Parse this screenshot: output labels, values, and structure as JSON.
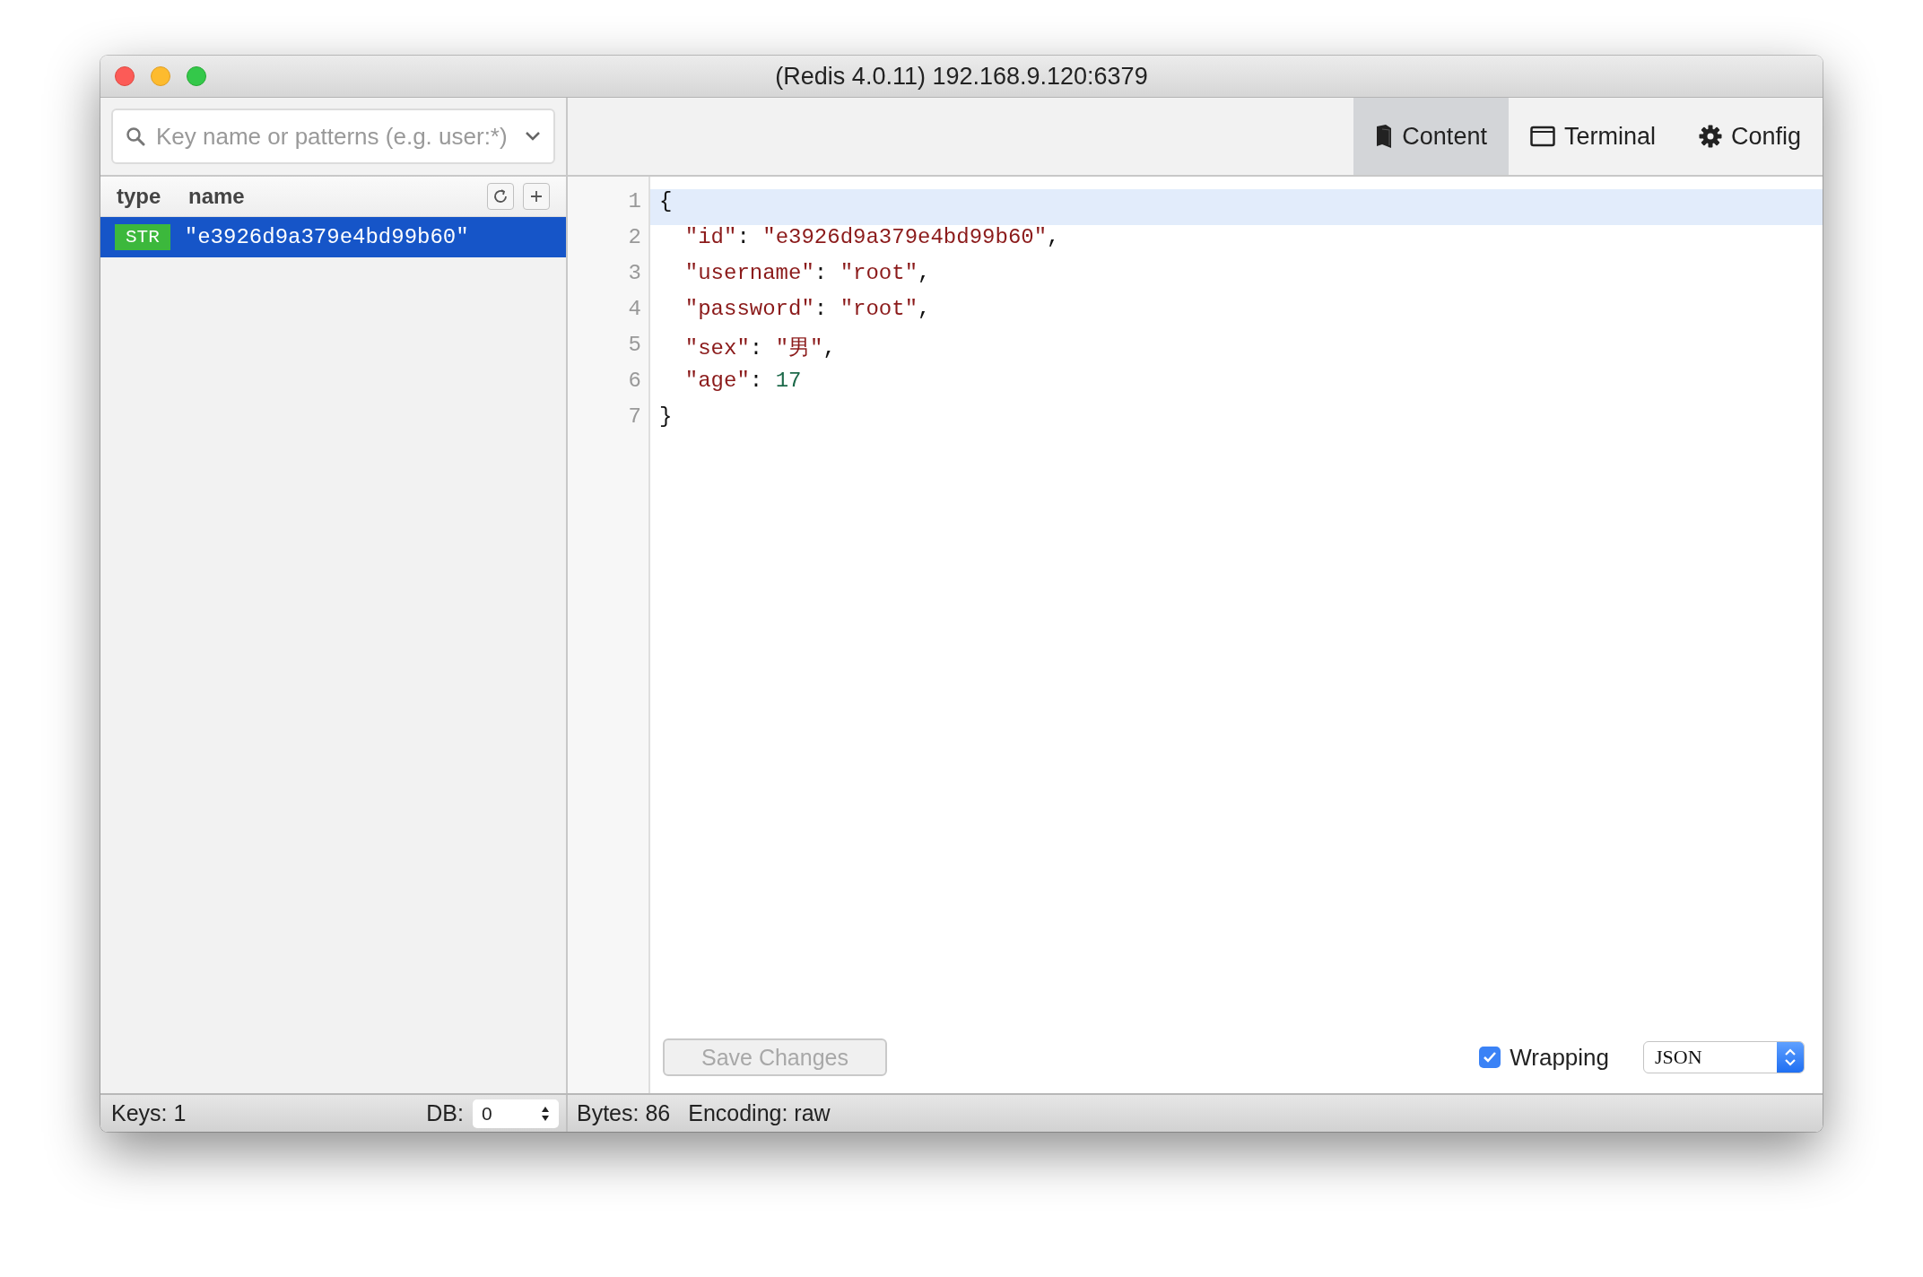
{
  "window": {
    "title": "(Redis 4.0.11) 192.168.9.120:6379"
  },
  "search": {
    "placeholder": "Key name or patterns (e.g. user:*)"
  },
  "key_list": {
    "columns": [
      "type",
      "name"
    ],
    "keys": [
      {
        "type": "STR",
        "name": "\"e3926d9a379e4bd99b60\"",
        "selected": true
      }
    ]
  },
  "tabs": [
    {
      "label": "Content",
      "selected": true
    },
    {
      "label": "Terminal",
      "selected": false
    },
    {
      "label": "Config",
      "selected": false
    }
  ],
  "editor": {
    "lines": [
      {
        "number": "1",
        "highlighted": true,
        "tokens": [
          {
            "kind": "punct",
            "text": "{"
          }
        ]
      },
      {
        "number": "2",
        "highlighted": false,
        "tokens": [
          {
            "kind": "key",
            "text": "  \"id\""
          },
          {
            "kind": "punct",
            "text": ": "
          },
          {
            "kind": "string",
            "text": "\"e3926d9a379e4bd99b60\""
          },
          {
            "kind": "punct",
            "text": ","
          }
        ]
      },
      {
        "number": "3",
        "highlighted": false,
        "tokens": [
          {
            "kind": "key",
            "text": "  \"username\""
          },
          {
            "kind": "punct",
            "text": ": "
          },
          {
            "kind": "string",
            "text": "\"root\""
          },
          {
            "kind": "punct",
            "text": ","
          }
        ]
      },
      {
        "number": "4",
        "highlighted": false,
        "tokens": [
          {
            "kind": "key",
            "text": "  \"password\""
          },
          {
            "kind": "punct",
            "text": ": "
          },
          {
            "kind": "string",
            "text": "\"root\""
          },
          {
            "kind": "punct",
            "text": ","
          }
        ]
      },
      {
        "number": "5",
        "highlighted": false,
        "tokens": [
          {
            "kind": "key",
            "text": "  \"sex\""
          },
          {
            "kind": "punct",
            "text": ": "
          },
          {
            "kind": "string",
            "text": "\"男\""
          },
          {
            "kind": "punct",
            "text": ","
          }
        ]
      },
      {
        "number": "6",
        "highlighted": false,
        "tokens": [
          {
            "kind": "key",
            "text": "  \"age\""
          },
          {
            "kind": "punct",
            "text": ": "
          },
          {
            "kind": "number",
            "text": "17"
          }
        ]
      },
      {
        "number": "7",
        "highlighted": false,
        "tokens": [
          {
            "kind": "punct",
            "text": "}"
          }
        ]
      }
    ]
  },
  "save_button": {
    "label": "Save Changes",
    "disabled": true
  },
  "wrapping": {
    "label": "Wrapping",
    "checked": true
  },
  "format_select": {
    "value": "JSON"
  },
  "status_bar": {
    "keys": "Keys: 1",
    "db_label": "DB:",
    "db_value": "0",
    "bytes": "Bytes: 86",
    "encoding": "Encoding: raw"
  }
}
